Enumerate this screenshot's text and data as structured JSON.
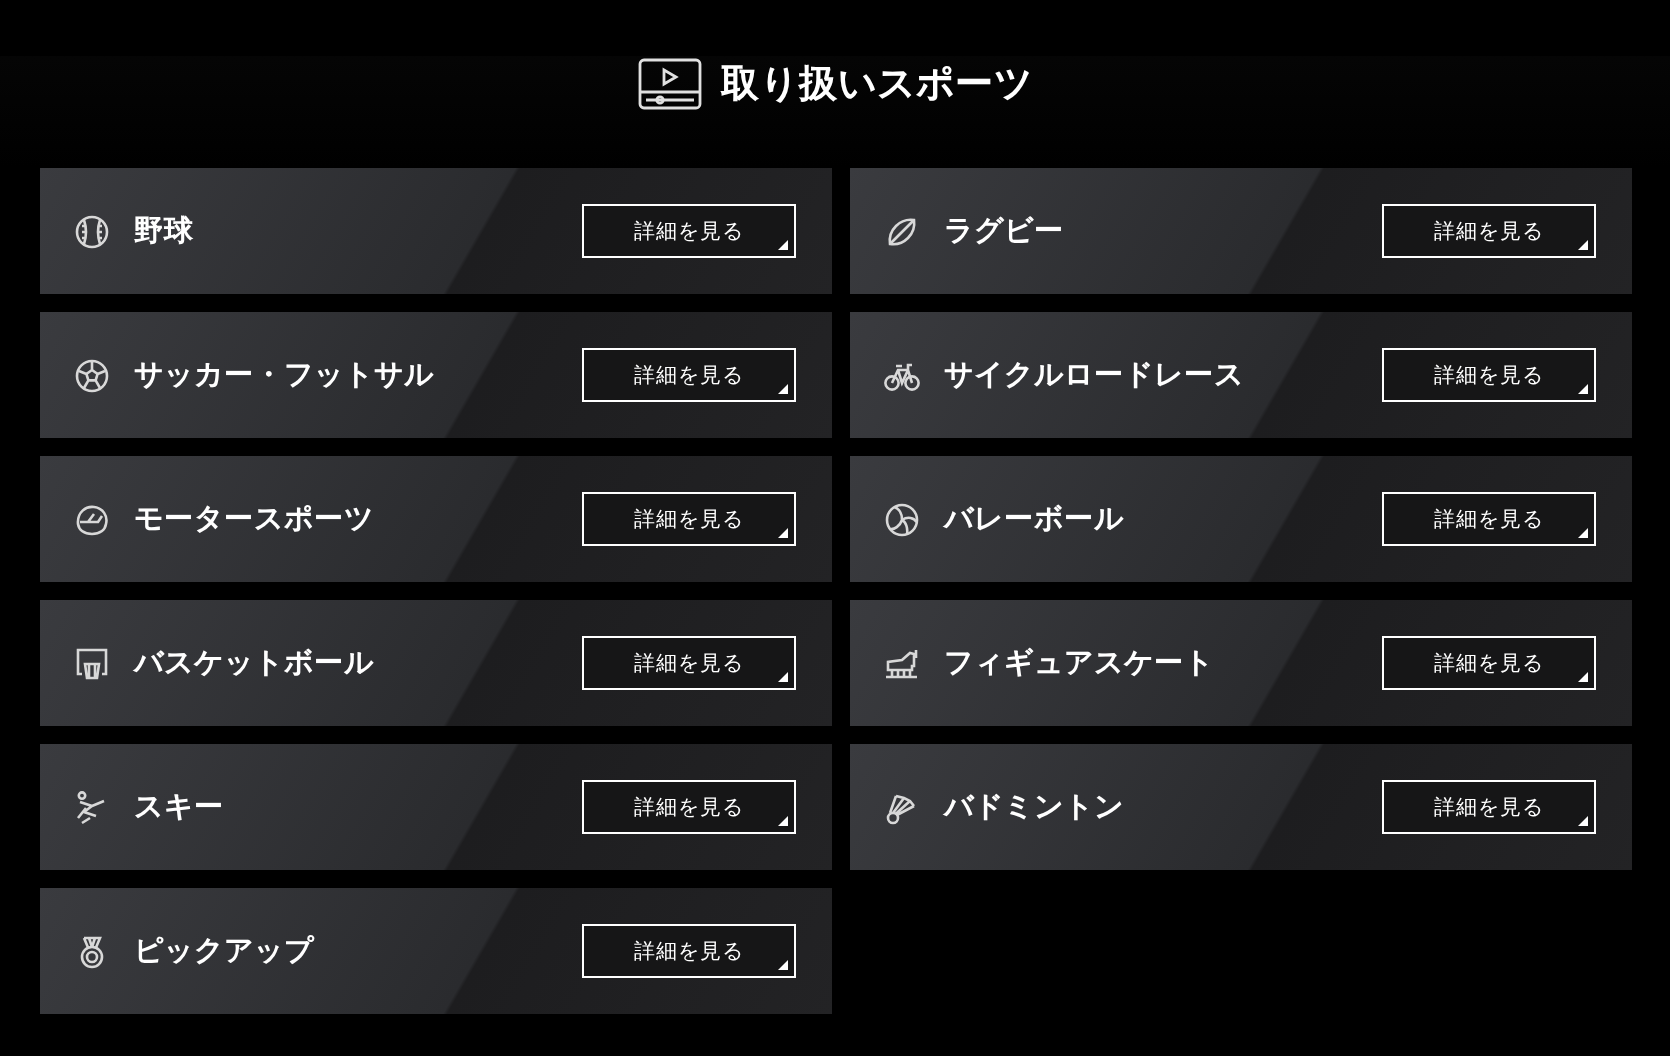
{
  "heading": {
    "title": "取り扱いスポーツ"
  },
  "sports": [
    {
      "kind": "baseball",
      "name": "野球",
      "button": "詳細を見る"
    },
    {
      "kind": "rugby",
      "name": "ラグビー",
      "button": "詳細を見る"
    },
    {
      "kind": "soccer",
      "name": "サッカー・フットサル",
      "button": "詳細を見る"
    },
    {
      "kind": "cycling",
      "name": "サイクルロードレース",
      "button": "詳細を見る"
    },
    {
      "kind": "motor",
      "name": "モータースポーツ",
      "button": "詳細を見る"
    },
    {
      "kind": "volleyball",
      "name": "バレーボール",
      "button": "詳細を見る"
    },
    {
      "kind": "basketball",
      "name": "バスケットボール",
      "button": "詳細を見る"
    },
    {
      "kind": "skate",
      "name": "フィギュアスケート",
      "button": "詳細を見る"
    },
    {
      "kind": "ski",
      "name": "スキー",
      "button": "詳細を見る"
    },
    {
      "kind": "badminton",
      "name": "バドミントン",
      "button": "詳細を見る"
    },
    {
      "kind": "pickup",
      "name": "ピックアップ",
      "button": "詳細を見る"
    }
  ]
}
